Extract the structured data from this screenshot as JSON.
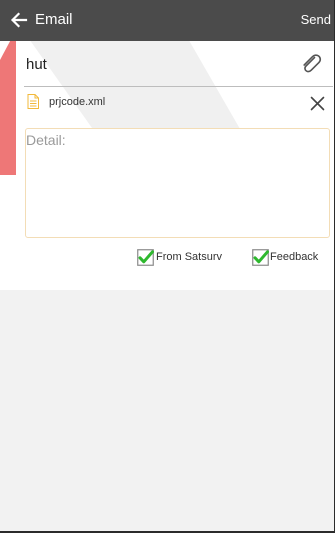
{
  "topbar": {
    "title": "Email",
    "send_label": "Send",
    "back_icon": "arrow-left-icon"
  },
  "subject": {
    "value": "hut",
    "attach_icon": "paperclip-icon"
  },
  "attachment": {
    "file_name": "prjcode.xml",
    "file_icon": "document-icon",
    "remove_icon": "close-icon"
  },
  "detail": {
    "placeholder": "Detail:",
    "value": ""
  },
  "options": {
    "from_satsurv": {
      "label": "From Satsurv",
      "checked": true
    },
    "feedback": {
      "label": "Feedback",
      "checked": true
    }
  },
  "colors": {
    "topbar_bg": "#4b4b4b",
    "check_green": "#2eb82e",
    "detail_border": "#f3ddb6",
    "bottom_bg": "#f2f2f2"
  }
}
